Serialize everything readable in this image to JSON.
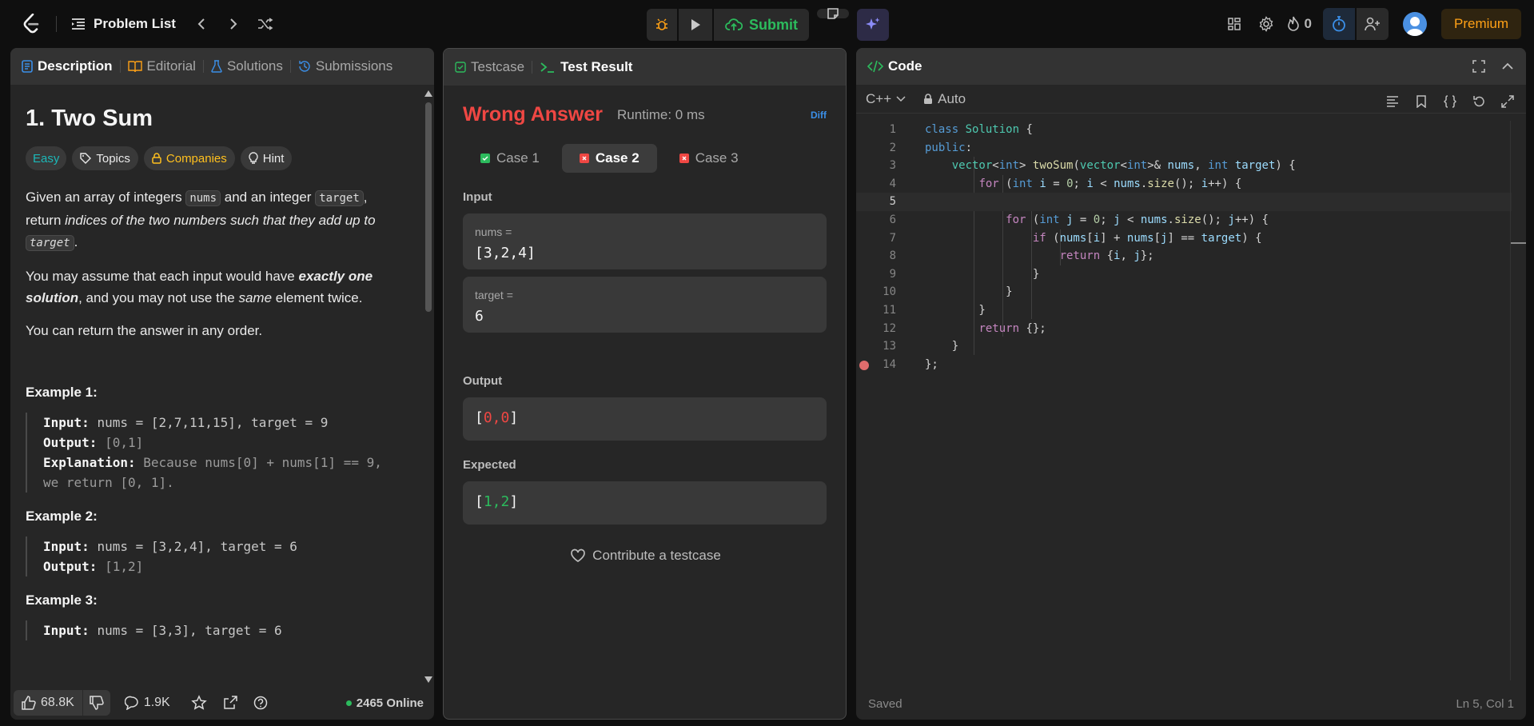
{
  "nav": {
    "problem_list": "Problem List",
    "submit_label": "Submit",
    "streak_count": "0",
    "premium_label": "Premium"
  },
  "left": {
    "tabs": [
      "Description",
      "Editorial",
      "Solutions",
      "Submissions"
    ],
    "title": "1. Two Sum",
    "chips": {
      "difficulty": "Easy",
      "topics": "Topics",
      "companies": "Companies",
      "hint": "Hint"
    },
    "para1": {
      "a": "Given an array of integers ",
      "code1": "nums",
      "b": " and an integer ",
      "code2": "target",
      "c": ", return ",
      "em": "indices of the two numbers such that they add up to",
      "d": " ",
      "code3": "target",
      "e": "."
    },
    "para2": {
      "a": "You may assume that each input would have ",
      "em": "exactly one solution",
      "b": ", and you may not use the ",
      "em2": "same",
      "c": " element twice."
    },
    "para3": "You can return the answer in any order.",
    "examples": [
      {
        "heading": "Example 1:",
        "input": "nums = [2,7,11,15], target = 9",
        "output": "[0,1]",
        "explanation": "Because nums[0] + nums[1] == 9, we return [0, 1]."
      },
      {
        "heading": "Example 2:",
        "input": "nums = [3,2,4], target = 6",
        "output": "[1,2]"
      },
      {
        "heading": "Example 3:",
        "input": "nums = [3,3], target = 6"
      }
    ],
    "labels": {
      "input": "Input:",
      "output": "Output:",
      "explanation": "Explanation:"
    },
    "footer": {
      "likes": "68.8K",
      "comments": "1.9K",
      "online": "2465 Online"
    }
  },
  "middle": {
    "tabs": [
      "Testcase",
      "Test Result"
    ],
    "status": "Wrong Answer",
    "runtime": "Runtime: 0 ms",
    "diff": "Diff",
    "cases": [
      {
        "label": "Case 1",
        "status": "pass"
      },
      {
        "label": "Case 2",
        "status": "fail"
      },
      {
        "label": "Case 3",
        "status": "fail"
      }
    ],
    "input_label": "Input",
    "nums_key": "nums =",
    "nums_value": "[3,2,4]",
    "target_key": "target =",
    "target_value": "6",
    "output_label": "Output",
    "output_value": {
      "open": "[",
      "body": "0,0",
      "close": "]"
    },
    "expected_label": "Expected",
    "expected_value": {
      "open": "[",
      "body": "1,2",
      "close": "]"
    },
    "contribute": "Contribute a testcase"
  },
  "right": {
    "title": "Code",
    "language": "C++",
    "mode": "Auto",
    "line_numbers": [
      "1",
      "2",
      "3",
      "4",
      "5",
      "6",
      "7",
      "8",
      "9",
      "10",
      "11",
      "12",
      "13",
      "14"
    ],
    "saved": "Saved",
    "cursor": "Ln 5, Col 1"
  },
  "colors": {
    "accent_orange": "#ffa116",
    "error_red": "#ef4743",
    "success_green": "#2cbb5d",
    "easy_teal": "#1cb8b8"
  }
}
